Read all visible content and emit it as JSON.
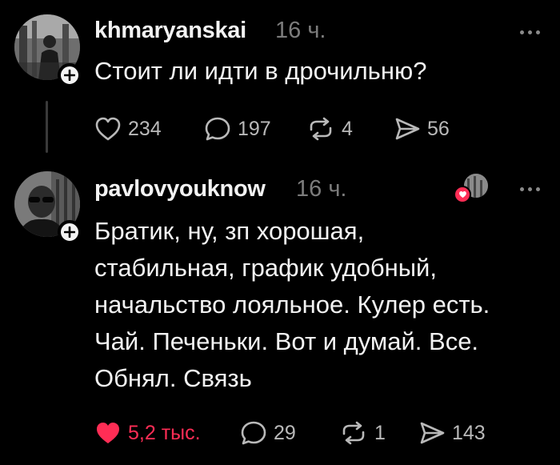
{
  "posts": [
    {
      "username": "khmaryanskai",
      "time": "16 ч.",
      "text_lines": [
        "Стоит ли идти в дрочильню?"
      ],
      "actions": {
        "likes": "234",
        "replies": "197",
        "reposts": "4",
        "shares": "56"
      },
      "icons": {
        "like": "heart-outline-icon",
        "reply": "speech-bubble-icon",
        "repost": "repost-icon",
        "share": "send-icon",
        "follow": "plus-icon",
        "menu": "more-icon"
      }
    },
    {
      "username": "pavlovyouknow",
      "time": "16 ч.",
      "text_lines": [
        "Братик, ну, зп хорошая,",
        "стабильная, график удобный,",
        "начальство лояльное. Кулер есть.",
        "Чай. Печеньки. Вот и думай. Все.",
        "Обнял. Связь"
      ],
      "actions": {
        "likes": "5,2 тыс.",
        "replies": "29",
        "reposts": "1",
        "shares": "143"
      },
      "liked": true,
      "icons": {
        "like": "heart-filled-icon",
        "reply": "speech-bubble-icon",
        "repost": "repost-icon",
        "share": "send-icon",
        "follow": "plus-icon",
        "menu": "more-icon",
        "liked_by_author": "heart-icon"
      }
    }
  ],
  "colors": {
    "background": "#000000",
    "text": "#f3f3f3",
    "muted": "#7c7c7c",
    "action": "#b9b9b9",
    "liked": "#ff2d55"
  }
}
